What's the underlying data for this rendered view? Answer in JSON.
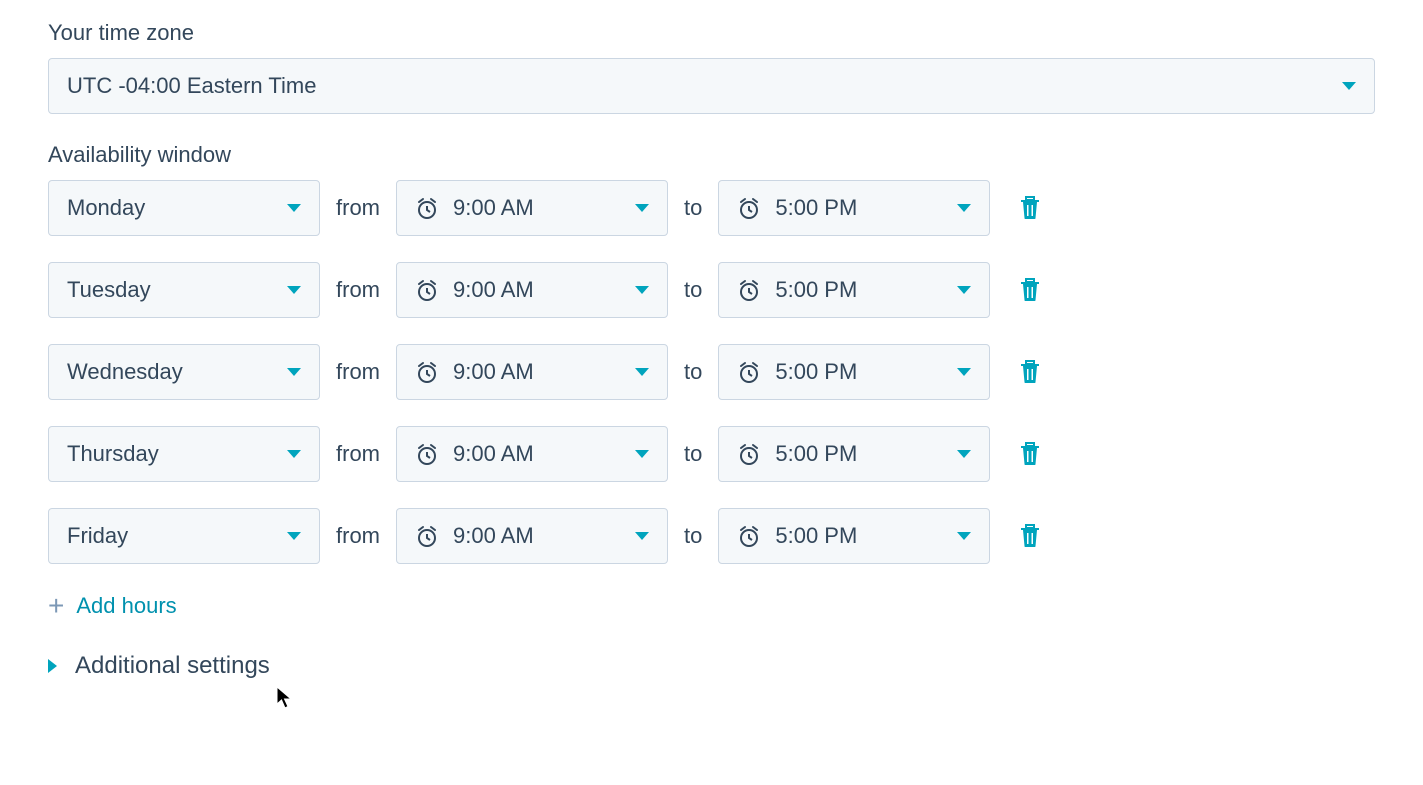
{
  "timezone": {
    "label": "Your time zone",
    "value": "UTC -04:00 Eastern Time"
  },
  "availability": {
    "label": "Availability window",
    "from_word": "from",
    "to_word": "to",
    "rows": [
      {
        "day": "Monday",
        "start": "9:00 AM",
        "end": "5:00 PM"
      },
      {
        "day": "Tuesday",
        "start": "9:00 AM",
        "end": "5:00 PM"
      },
      {
        "day": "Wednesday",
        "start": "9:00 AM",
        "end": "5:00 PM"
      },
      {
        "day": "Thursday",
        "start": "9:00 AM",
        "end": "5:00 PM"
      },
      {
        "day": "Friday",
        "start": "9:00 AM",
        "end": "5:00 PM"
      }
    ]
  },
  "add_hours_label": "Add hours",
  "additional_settings_label": "Additional settings"
}
